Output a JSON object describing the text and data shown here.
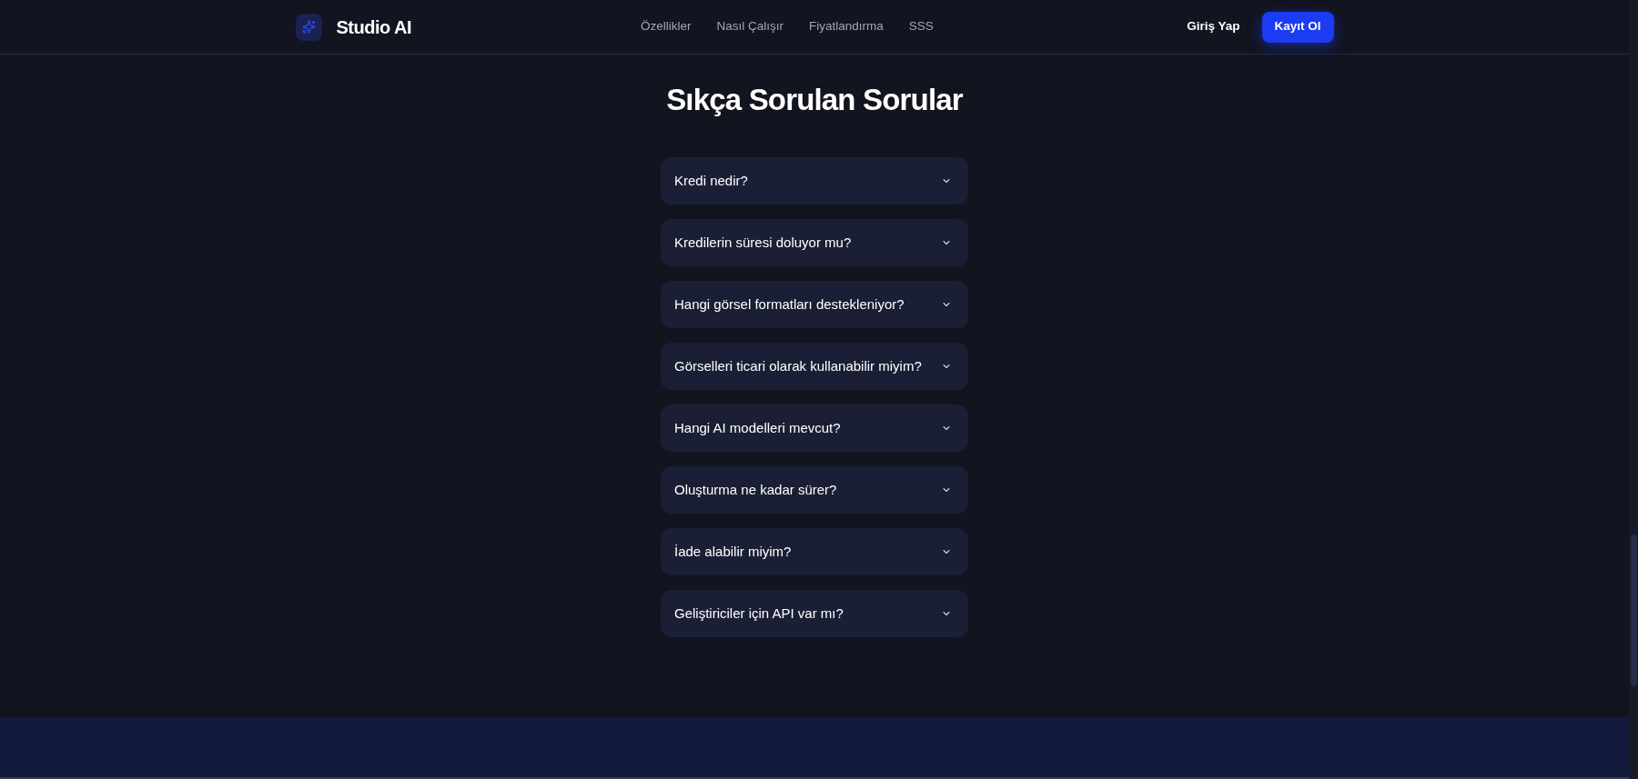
{
  "header": {
    "logo": {
      "name": "Studio AI"
    },
    "nav": [
      {
        "label": "Özellikler"
      },
      {
        "label": "Nasıl Çalışır"
      },
      {
        "label": "Fiyatlandırma"
      },
      {
        "label": "SSS"
      }
    ],
    "login": "Giriş Yap",
    "signup": "Kayıt Ol"
  },
  "faq": {
    "title": "Sıkça Sorulan Sorular",
    "items": [
      {
        "question": "Kredi nedir?",
        "expanded": false
      },
      {
        "question": "Kredilerin süresi doluyor mu?",
        "expanded": false
      },
      {
        "question": "Hangi görsel formatları destekleniyor?",
        "expanded": false
      },
      {
        "question": "Görselleri ticari olarak kullanabilir miyim?",
        "expanded": false
      },
      {
        "question": "Hangi AI modelleri mevcut?",
        "expanded": false
      },
      {
        "question": "Oluşturma ne kadar sürer?",
        "expanded": false
      },
      {
        "question": "İade alabilir miyim?",
        "expanded": false
      },
      {
        "question": "Geliştiriciler için API var mı?",
        "expanded": false
      }
    ]
  }
}
